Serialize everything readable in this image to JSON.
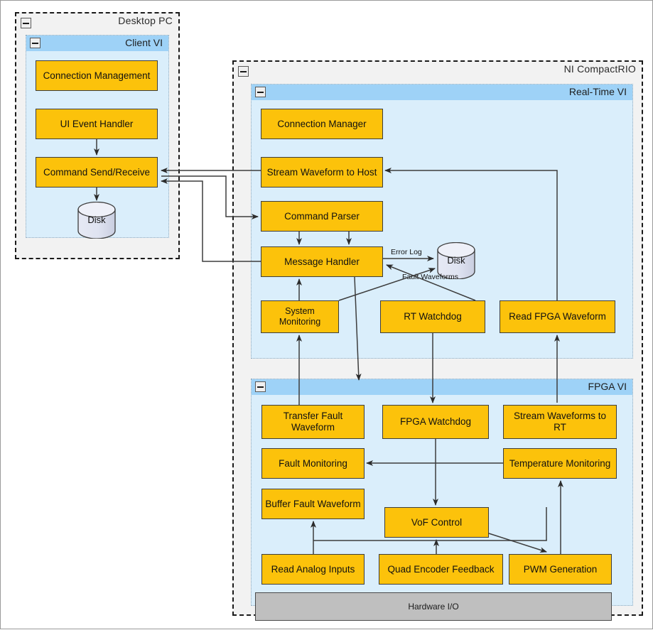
{
  "diagram": {
    "title": "Software architecture block diagram",
    "colors": {
      "node_fill": "#FCC20B",
      "node_stroke": "#3D3D3D",
      "vi_panel_fill": "#DAEEFB",
      "vi_header_fill": "#9ED2F7",
      "package_fill": "#F2F2F2",
      "package_stroke": "#1A1A1A",
      "hardware_fill": "#BFBFBF",
      "wire_stroke": "#3D3D3D"
    }
  },
  "packages": {
    "desktop_pc": {
      "title": "Desktop  PC",
      "collapse_icon": "minus-icon"
    },
    "ni_compactrio": {
      "title": "NI CompactRIO",
      "collapse_icon": "minus-icon"
    }
  },
  "vis": {
    "client": {
      "title": "Client VI",
      "collapse_icon": "minus-icon"
    },
    "realtime": {
      "title": "Real-Time VI",
      "collapse_icon": "minus-icon"
    },
    "fpga": {
      "title": "FPGA VI",
      "collapse_icon": "minus-icon"
    }
  },
  "nodes": {
    "connection_management": "Connection Management",
    "ui_event_handler": "UI Event Handler",
    "command_send_receive": "Command Send/Receive",
    "client_disk": "Disk",
    "connection_manager": "Connection Manager",
    "stream_waveform_to_host": "Stream Waveform to Host",
    "command_parser": "Command Parser",
    "message_handler": "Message  Handler",
    "rt_disk": "Disk",
    "system_monitoring": "System Monitoring",
    "rt_watchdog": "RT Watchdog",
    "read_fpga_waveform": "Read FPGA Waveform",
    "transfer_fault_waveform": "Transfer Fault Waveform",
    "fpga_watchdog": "FPGA Watchdog",
    "stream_waveforms_to_rt": "Stream Waveforms to RT",
    "fault_monitoring": "Fault Monitoring",
    "temperature_monitoring": "Temperature Monitoring",
    "buffer_fault_waveform": "Buffer Fault Waveform",
    "vof_control": "VoF Control",
    "read_analog_inputs": "Read Analog Inputs",
    "quad_encoder_feedback": "Quad Encoder Feedback",
    "pwm_generation": "PWM Generation",
    "hardware_io": "Hardware I/O"
  },
  "edge_labels": {
    "error_log": "Error Log",
    "fault_waveforms": "Fault Waveforms"
  }
}
